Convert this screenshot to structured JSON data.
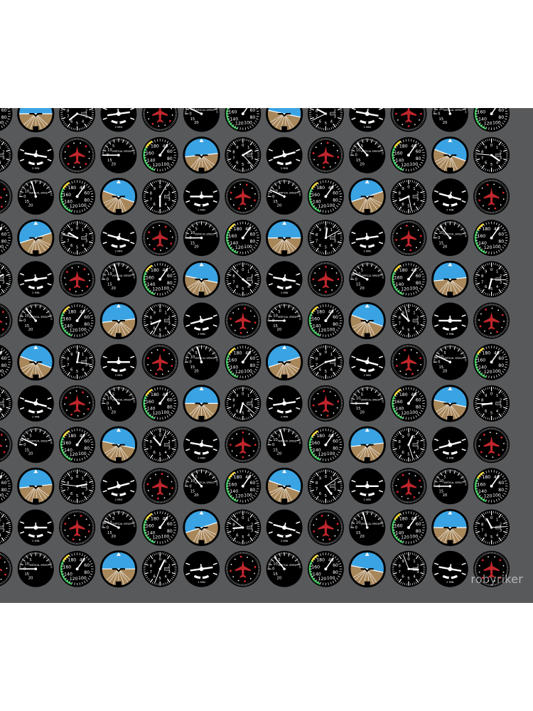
{
  "colors": {
    "background": "#58595b",
    "gauge_face": "#000000",
    "gauge_white": "#ffffff",
    "sky": "#3aa3e3",
    "ground": "#a8875b",
    "arc_green": "#2bb34a",
    "arc_yellow": "#f1d11e",
    "arc_red": "#d6262c",
    "aircraft_red": "#c0262c",
    "heading_grey": "#b3b3b3"
  },
  "pattern": {
    "instruments": [
      "airspeed-indicator",
      "attitude-indicator",
      "altimeter",
      "turn-coordinator",
      "heading-indicator",
      "vertical-speed-indicator"
    ],
    "columns": 13,
    "rows": 12
  },
  "instrument_labels": {
    "airspeed_ticks": [
      "180",
      "40",
      "160",
      "60",
      "140",
      "80",
      "120",
      "100"
    ],
    "vsi_text": "VERTICAL SPEED",
    "vsi_ticks": [
      "10",
      "5",
      "20",
      "15"
    ],
    "turn_text": "2 MIN",
    "heading_text": "",
    "altimeter_text": ""
  },
  "watermark": "robyriker"
}
